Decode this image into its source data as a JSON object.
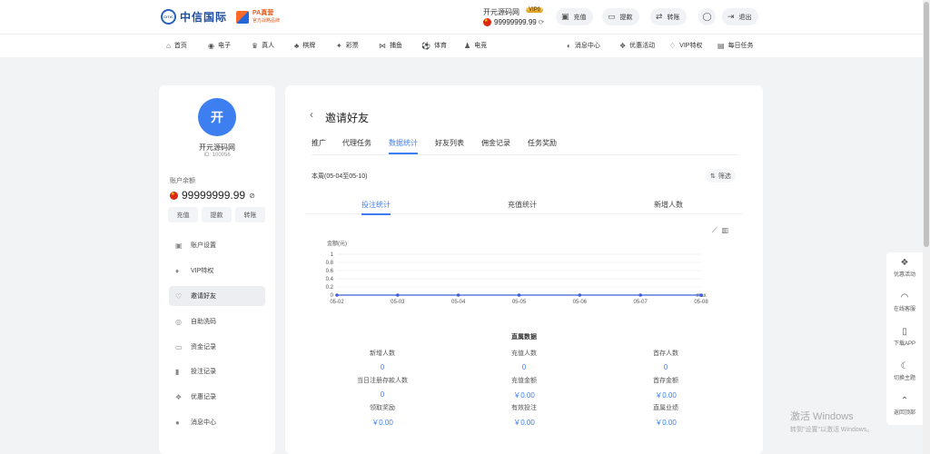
{
  "header": {
    "logo_main": "中信国际",
    "logo_seal": "CITIC",
    "logo_partner_title": "PA真营",
    "logo_partner_sub": "官方战略品牌",
    "username": "开元源码网",
    "vip_badge": "VIP0",
    "balance": "99999999.99",
    "buttons": [
      {
        "label": "充值",
        "icon": "wallet-icon"
      },
      {
        "label": "提款",
        "icon": "card-icon"
      },
      {
        "label": "转账",
        "icon": "transfer-icon"
      }
    ],
    "profile_icon": "user-icon",
    "logout_label": "退出"
  },
  "nav": {
    "left": [
      {
        "label": "首页",
        "icon": "home-icon"
      },
      {
        "label": "电子",
        "icon": "game-icon"
      },
      {
        "label": "真人",
        "icon": "live-icon"
      },
      {
        "label": "棋牌",
        "icon": "cards-icon"
      },
      {
        "label": "彩票",
        "icon": "lottery-icon"
      },
      {
        "label": "捕鱼",
        "icon": "fish-icon"
      },
      {
        "label": "体育",
        "icon": "sports-icon"
      },
      {
        "label": "电竞",
        "icon": "esports-icon"
      }
    ],
    "right": [
      {
        "label": "消息中心",
        "icon": "chat-icon"
      },
      {
        "label": "优惠活动",
        "icon": "gift-icon"
      },
      {
        "label": "VIP特权",
        "icon": "vip-icon"
      },
      {
        "label": "每日任务",
        "icon": "task-icon"
      }
    ]
  },
  "sidebar": {
    "avatar_char": "开",
    "name": "开元源码网",
    "id": "ID: 100056",
    "balance_label": "账户余额",
    "balance": "99999999.99",
    "actions": [
      "充值",
      "提款",
      "转账"
    ],
    "menu": [
      {
        "label": "账户设置",
        "icon": "id-card-icon"
      },
      {
        "label": "VIP特权",
        "icon": "diamond-icon"
      },
      {
        "label": "邀请好友",
        "icon": "invite-icon",
        "active": true
      },
      {
        "label": "自助洗码",
        "icon": "refresh-icon"
      },
      {
        "label": "资金记录",
        "icon": "wallet-icon"
      },
      {
        "label": "投注记录",
        "icon": "clipboard-icon"
      },
      {
        "label": "优惠记录",
        "icon": "gift-icon"
      },
      {
        "label": "消息中心",
        "icon": "chat-icon"
      }
    ]
  },
  "main": {
    "title": "邀请好友",
    "tabs": [
      "推广",
      "代理任务",
      "数据统计",
      "好友列表",
      "佣金记录",
      "任务奖励"
    ],
    "active_tab": "数据统计",
    "week": "本周(05-04至05-10)",
    "filter": "筛选",
    "subtabs": [
      "投注统计",
      "充值统计",
      "新增人数"
    ],
    "active_subtab": "投注统计",
    "section_title": "直属数据",
    "stats": [
      {
        "label": "新增人数",
        "value": "0"
      },
      {
        "label": "充值人数",
        "value": "0"
      },
      {
        "label": "首存人数",
        "value": "0"
      },
      {
        "label": "当日注册存款人数",
        "value": "0"
      },
      {
        "label": "充值金额",
        "value": "￥0.00"
      },
      {
        "label": "首存金额",
        "value": "￥0.00"
      },
      {
        "label": "领取奖励",
        "value": "￥0.00"
      },
      {
        "label": "有效投注",
        "value": "￥0.00"
      },
      {
        "label": "直属业绩",
        "value": "￥0.00"
      }
    ]
  },
  "chart_data": {
    "type": "line",
    "ylabel": "金额(元)",
    "categories": [
      "05-02",
      "05-03",
      "05-04",
      "05-05",
      "05-06",
      "05-07",
      "05-08"
    ],
    "series": [
      {
        "values": [
          0,
          0,
          0,
          0,
          0,
          0,
          0
        ]
      }
    ],
    "ylim": [
      0,
      1
    ],
    "yticks": [
      "0",
      "0.2",
      "0.4",
      "0.6",
      "0.8",
      "1"
    ],
    "x_end_label": "max",
    "line_color": "#3d5fd9",
    "grid": true
  },
  "float": [
    {
      "label": "优惠活动",
      "icon": "gift-icon"
    },
    {
      "label": "在线客服",
      "icon": "headset-icon"
    },
    {
      "label": "下载APP",
      "icon": "phone-icon"
    },
    {
      "label": "切换主题",
      "icon": "moon-icon"
    },
    {
      "label": "返回顶部",
      "icon": "chevron-up-icon"
    }
  ],
  "watermark": {
    "line1": "激活 Windows",
    "line2": "转到\"设置\"以激活 Windows。"
  },
  "colors": {
    "accent": "#3d7ff0",
    "avatar": "#3d7ff0"
  }
}
